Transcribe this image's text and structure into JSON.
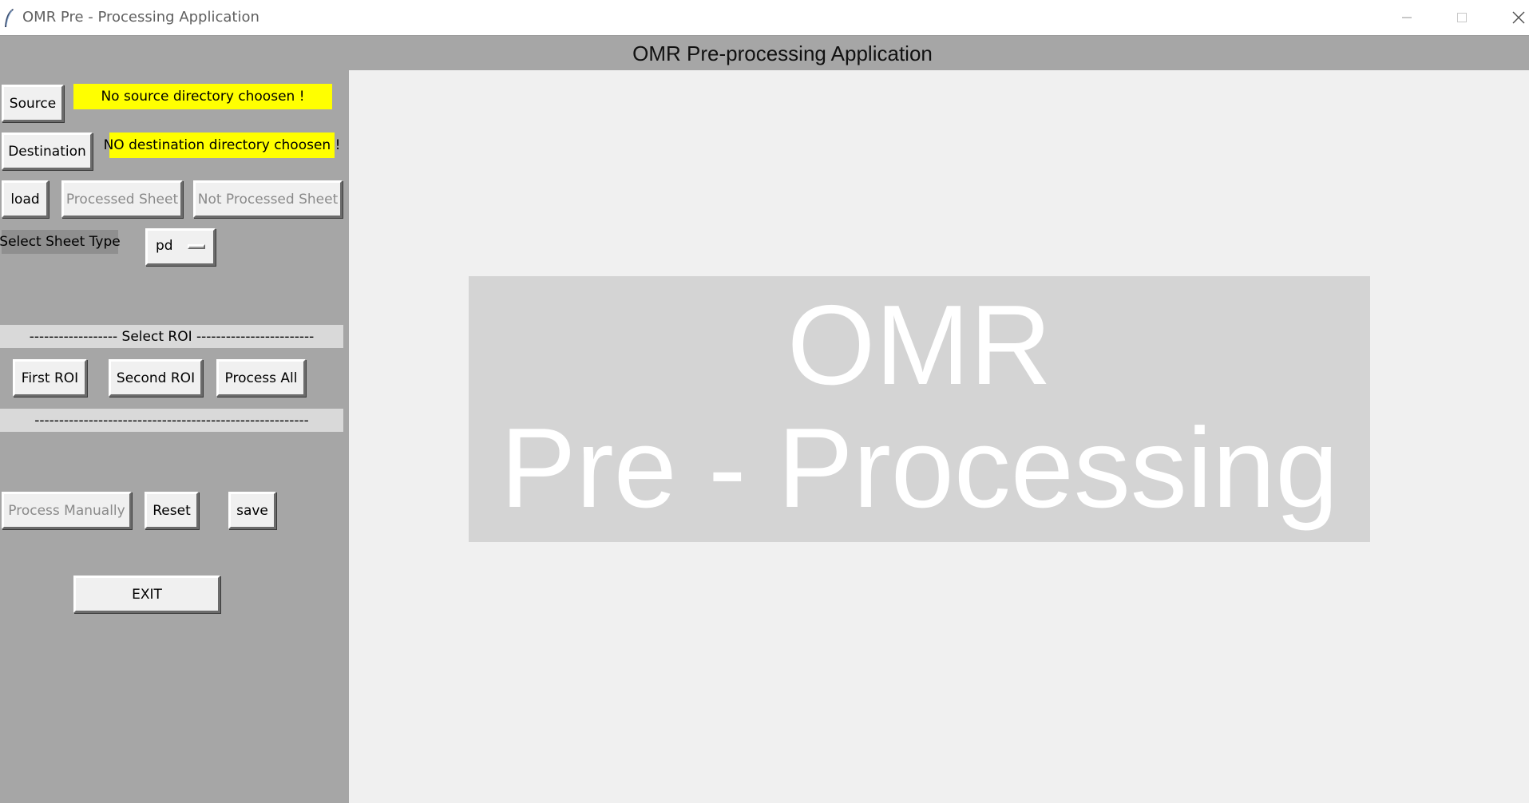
{
  "window": {
    "title": "OMR Pre - Processing Application",
    "controls": [
      "minimize-icon",
      "maximize-icon",
      "close-icon"
    ]
  },
  "header": {
    "title": "OMR Pre-processing Application"
  },
  "sidebar": {
    "source_button": "Source",
    "source_status": "No source directory choosen !",
    "destination_button": "Destination",
    "destination_status": "NO destination directory choosen !",
    "load_button": "load",
    "processed_sheet_button": "Processed Sheet",
    "not_processed_sheet_button": "Not Processed Sheet",
    "sheet_type_label": "Select Sheet Type",
    "sheet_type_value": "pd",
    "roi_separator": "------------------ Select ROI ------------------------",
    "first_roi_button": "First ROI",
    "second_roi_button": "Second ROI",
    "process_all_button": "Process All",
    "bottom_separator": "--------------------------------------------------------",
    "process_manually_button": "Process Manually",
    "reset_button": "Reset",
    "save_button": "save",
    "exit_button": "EXIT"
  },
  "splash": {
    "line1": "OMR",
    "line2": "Pre - Processing"
  },
  "colors": {
    "panel": "#a6a6a6",
    "status_highlight": "#ffff00",
    "splash_bg": "#d4d4d4",
    "splash_text": "#ffffff"
  }
}
